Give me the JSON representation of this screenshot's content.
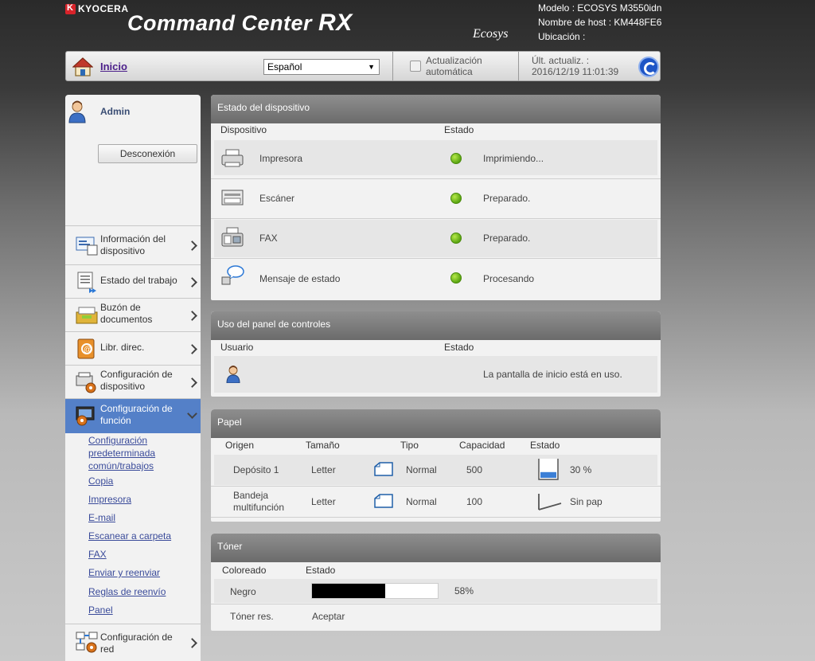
{
  "header": {
    "brand": "KYOCERA",
    "product_title_main": "Command Center",
    "product_title_suffix": "RX",
    "ecosys_logo": "Ecosys",
    "model": "Modelo : ECOSYS M3550idn",
    "hostname": "Nombre de host : KM448FE6",
    "location": "Ubicación :"
  },
  "toolbar": {
    "home_label": "Inicio",
    "language": "Español",
    "auto_update_label": "Actualización automática",
    "last_update_label": "Últ. actualiz. :",
    "last_update_value": "2016/12/19 11:01:39"
  },
  "sidebar": {
    "user": "Admin",
    "logout_label": "Desconexión",
    "items": [
      {
        "label": "Información del dispositivo",
        "icon": "device-info-icon"
      },
      {
        "label": "Estado del trabajo",
        "icon": "job-status-icon"
      },
      {
        "label": "Buzón de documentos",
        "icon": "document-box-icon"
      },
      {
        "label": "Libr. direc.",
        "icon": "address-book-icon"
      },
      {
        "label": "Configuración de dispositivo",
        "icon": "device-settings-icon"
      },
      {
        "label": "Configuración de función",
        "icon": "function-settings-icon"
      },
      {
        "label": "Configuración de red",
        "icon": "network-settings-icon"
      }
    ],
    "sub_links": [
      "Configuración predeterminada común/trabajos",
      "Copia",
      "Impresora",
      "E-mail",
      "Escanear a carpeta",
      "FAX",
      "Enviar y reenviar",
      "Reglas de reenvío",
      "Panel"
    ]
  },
  "device_status": {
    "title": "Estado del dispositivo",
    "col_device": "Dispositivo",
    "col_status": "Estado",
    "rows": [
      {
        "device": "Impresora",
        "status": "Imprimiendo...",
        "icon": "printer-icon",
        "indicator": "#6ab820"
      },
      {
        "device": "Escáner",
        "status": "Preparado.",
        "icon": "scanner-icon",
        "indicator": "#6ab820"
      },
      {
        "device": "FAX",
        "status": "Preparado.",
        "icon": "fax-icon",
        "indicator": "#6ab820"
      },
      {
        "device": "Mensaje de estado",
        "status": "Procesando",
        "icon": "status-message-icon",
        "indicator": "#6ab820"
      }
    ]
  },
  "panel_usage": {
    "title": "Uso del panel de controles",
    "col_user": "Usuario",
    "col_status": "Estado",
    "status": "La pantalla de inicio está en uso."
  },
  "paper": {
    "title": "Papel",
    "headers": [
      "Origen",
      "Tamaño",
      "Tipo",
      "Capacidad",
      "Estado"
    ],
    "rows": [
      {
        "source": "Depósito 1",
        "size": "Letter",
        "type": "Normal",
        "capacity": "500",
        "status": "30 %",
        "level": 0.3
      },
      {
        "source": "Bandeja multifunción",
        "size": "Letter",
        "type": "Normal",
        "capacity": "100",
        "status": "Sin pap",
        "level": 0
      }
    ]
  },
  "toner": {
    "title": "Tóner",
    "col_color": "Coloreado",
    "col_status": "Estado",
    "color": "Negro",
    "level_percent": 58,
    "level_label": "58%",
    "residual_label": "Tóner res.",
    "residual_value": "Aceptar"
  }
}
